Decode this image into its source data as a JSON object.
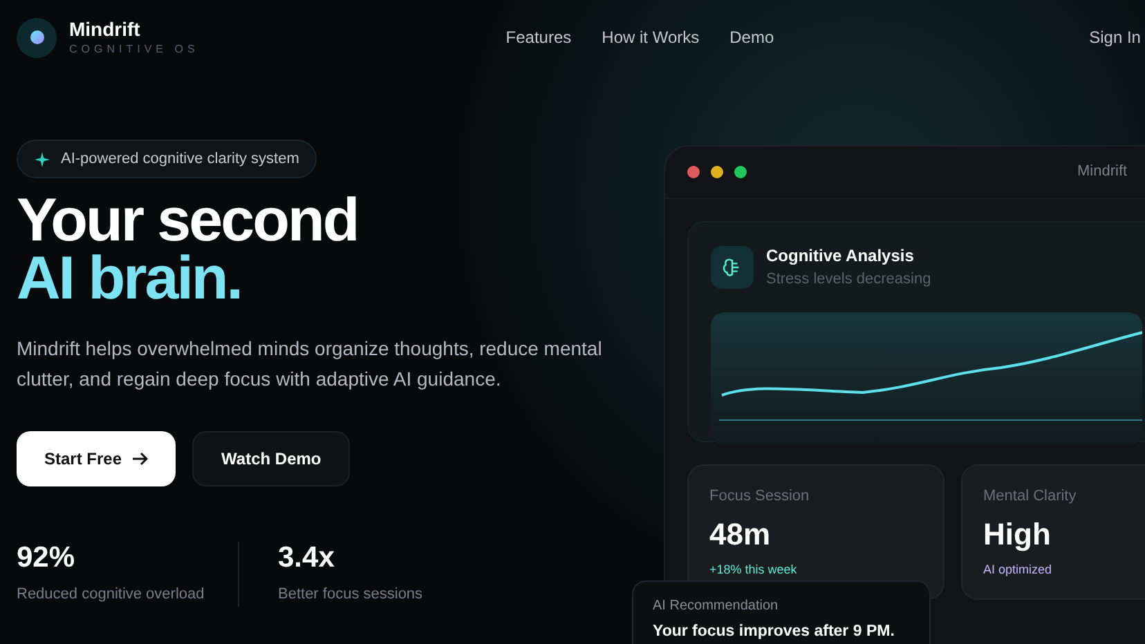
{
  "brand": {
    "name": "Mindrift",
    "tagline": "COGNITIVE OS"
  },
  "nav": [
    {
      "label": "Features"
    },
    {
      "label": "How it Works"
    },
    {
      "label": "Demo"
    }
  ],
  "sign_in": "Sign In",
  "badge": "AI-powered cognitive clarity system",
  "headline": {
    "line_1": "Your second",
    "line_2": "AI brain."
  },
  "description": "Mindrift helps overwhelmed minds organize thoughts, reduce mental clutter, and regain deep focus with adaptive AI guidance.",
  "buttons": [
    {
      "label": "Start Free",
      "kind": "primary"
    },
    {
      "label": "Watch Demo",
      "kind": "secondary"
    }
  ],
  "stats": [
    {
      "value": "92%",
      "label": "Reduced cognitive overload"
    },
    {
      "value": "3.4x",
      "label": "Better focus sessions"
    }
  ],
  "app_window": {
    "title": "Mindrift",
    "analysis": {
      "title": "Cognitive Analysis",
      "subtitle": "Stress levels decreasing"
    },
    "metrics": [
      {
        "label": "Focus Session",
        "value": "48m",
        "note": "+18% this week",
        "color": "#5eead4"
      },
      {
        "label": "Mental Clarity",
        "value": "High",
        "note": "AI optimized",
        "color": "#c4b5fd"
      }
    ]
  },
  "recommendation": {
    "label": "AI Recommendation",
    "text": "Your focus improves after 9 PM."
  }
}
